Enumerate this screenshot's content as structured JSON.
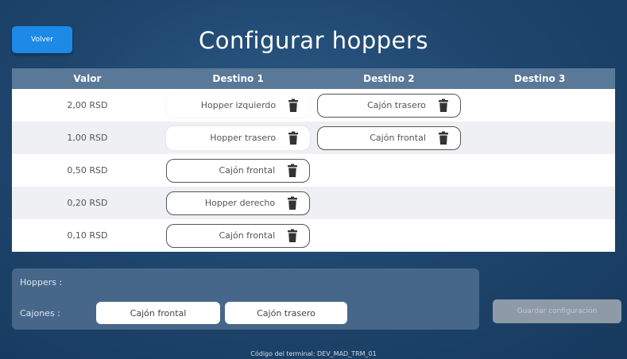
{
  "header": {
    "back_label": "Volver",
    "title": "Configurar hoppers"
  },
  "table": {
    "columns": [
      "Valor",
      "Destino 1",
      "Destino 2",
      "Destino 3"
    ],
    "rows": [
      {
        "valor": "2,00 RSD",
        "destino1": "Hopper izquierdo",
        "destino2": "Cajón trasero",
        "destino3": ""
      },
      {
        "valor": "1,00 RSD",
        "destino1": "Hopper trasero",
        "destino2": "Cajón frontal",
        "destino3": ""
      },
      {
        "valor": "0,50 RSD",
        "destino1": "Cajón frontal",
        "destino2": "",
        "destino3": ""
      },
      {
        "valor": "0,20 RSD",
        "destino1": "Hopper derecho",
        "destino2": "",
        "destino3": ""
      },
      {
        "valor": "0,10 RSD",
        "destino1": "Cajón frontal",
        "destino2": "",
        "destino3": ""
      }
    ]
  },
  "panel": {
    "hoppers_label": "Hoppers :",
    "cajones_label": "Cajones :",
    "cajones": [
      "Cajón frontal",
      "Cajón trasero"
    ]
  },
  "actions": {
    "save_label": "Guardar configuración"
  },
  "footer": {
    "terminal_text": "Código del terminal: DEV_MAD_TRM_01"
  },
  "icons": {
    "delete": "trash-icon"
  },
  "colors": {
    "accent": "#1c8ae6",
    "header_bg": "#5a7897",
    "panel_bg": "#47678a",
    "disabled_button": "#8e9aa7"
  }
}
